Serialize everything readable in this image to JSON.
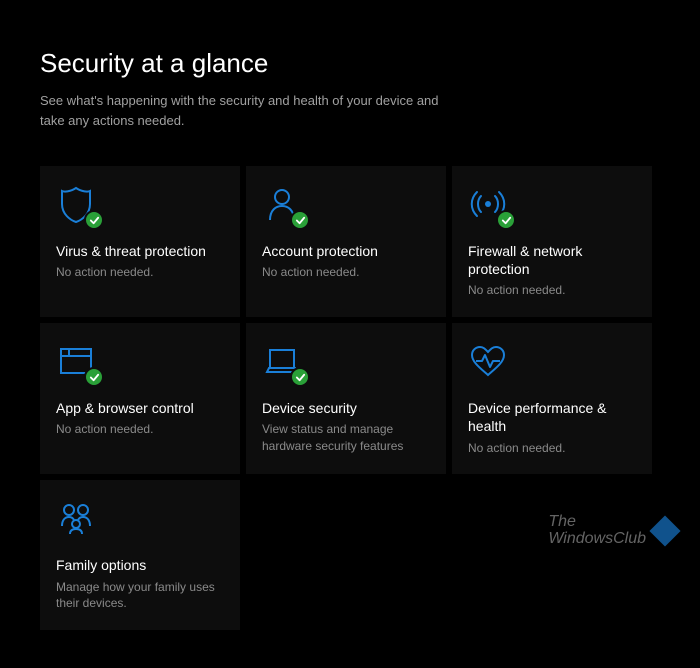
{
  "header": {
    "title": "Security at a glance",
    "subtitle": "See what's happening with the security and health of your device and take any actions needed."
  },
  "tiles": [
    {
      "icon": "shield-icon",
      "title": "Virus & threat protection",
      "status": "No action needed.",
      "badge": true
    },
    {
      "icon": "person-icon",
      "title": "Account protection",
      "status": "No action needed.",
      "badge": true
    },
    {
      "icon": "antenna-icon",
      "title": "Firewall & network protection",
      "status": "No action needed.",
      "badge": true
    },
    {
      "icon": "window-icon",
      "title": "App & browser control",
      "status": "No action needed.",
      "badge": true
    },
    {
      "icon": "laptop-icon",
      "title": "Device security",
      "status": "View status and manage hardware security features",
      "badge": true
    },
    {
      "icon": "heart-icon",
      "title": "Device performance & health",
      "status": "No action needed.",
      "badge": false
    },
    {
      "icon": "family-icon",
      "title": "Family options",
      "status": "Manage how your family uses their devices.",
      "badge": false
    }
  ],
  "watermark": {
    "line1": "The",
    "line2": "WindowsClub"
  },
  "colors": {
    "icon_stroke": "#1a7fd8",
    "badge_bg": "#2aa038"
  }
}
